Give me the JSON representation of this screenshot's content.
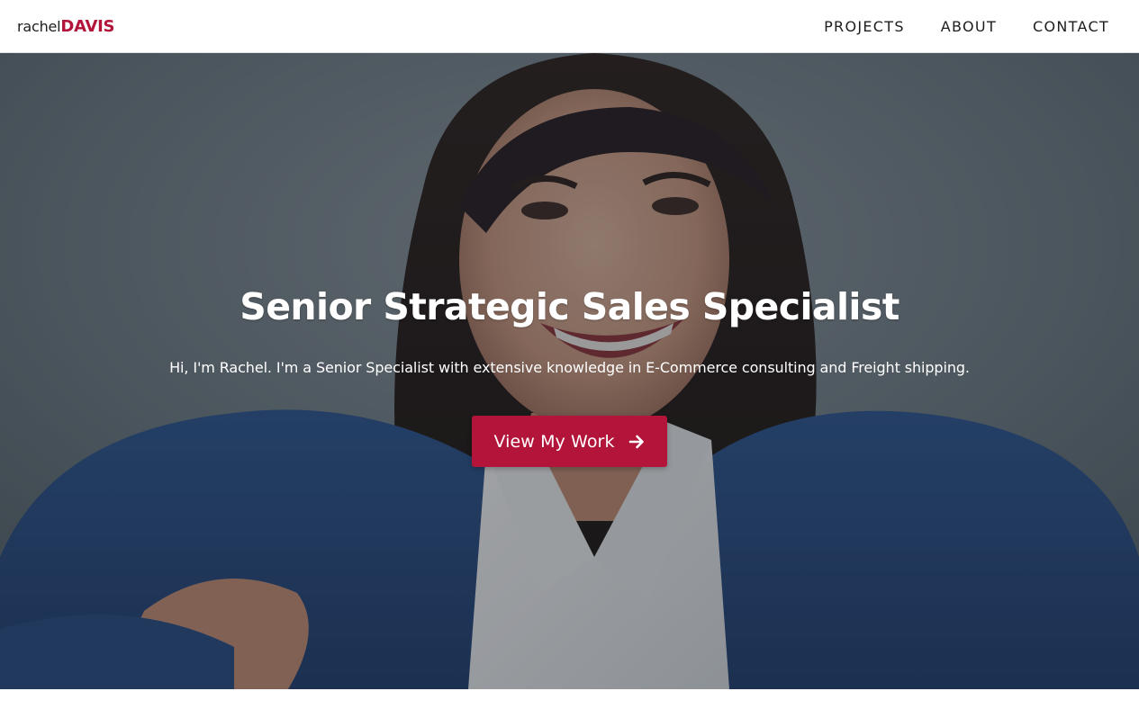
{
  "brand": {
    "first_name": "rachel",
    "last_name": "DAVIS",
    "accent_color": "#b3143a"
  },
  "nav": {
    "items": [
      {
        "label": "PROJECTS"
      },
      {
        "label": "ABOUT"
      },
      {
        "label": "CONTACT"
      }
    ]
  },
  "hero": {
    "title": "Senior Strategic Sales Specialist",
    "subtitle": "Hi, I'm Rachel. I'm a Senior Specialist with extensive knowledge in E-Commerce consulting and Freight shipping.",
    "cta": {
      "label": "View My Work",
      "icon": "arrow-right-icon",
      "color": "#b3143a"
    },
    "background_image": "portrait-photo",
    "overlay_color": "#1c2228"
  }
}
